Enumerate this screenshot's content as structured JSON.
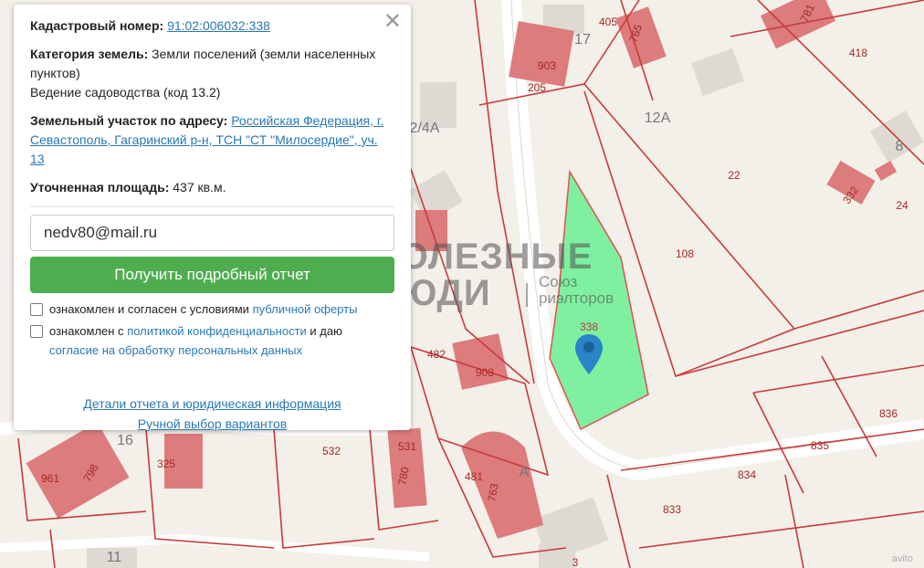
{
  "info": {
    "cadastral_label": "Кадастровый номер:",
    "cadastral_value": "91:02:006032:338",
    "category_label": "Категория земель:",
    "category_value": "Земли поселений (земли населенных пунктов)",
    "category_use": "Ведение садоводства (код 13.2)",
    "address_label": "Земельный участок по адресу:",
    "address_value": "Российская Федерация, г. Севастополь, Гагаринский р-н, ТСН \"СТ \"Милосердие\", уч. 13",
    "area_label": "Уточненная площадь:",
    "area_value": "437 кв.м.",
    "close_glyph": "✕"
  },
  "form": {
    "email_value": "nedv80@mail.ru",
    "button_label": "Получить подробный отчет",
    "check1_text": "ознакомлен и согласен с условиями ",
    "check1_link": "публичной оферты",
    "check2_text": "ознакомлен с ",
    "check2_link": "политикой конфиденциальности",
    "check2_text2": " и даю ",
    "check2_link2": "согласие на обработку персональных данных"
  },
  "links": {
    "details": "Детали отчета и юридическая информация",
    "manual": "Ручной выбор вариантов"
  },
  "watermark": {
    "line1": "ПОЛЕЗНЫЕ",
    "line2": "ЛЮДИ",
    "sub1": "Союз",
    "sub2": "риэлторов"
  },
  "corner_text": "avito",
  "map": {
    "labels": [
      {
        "name": "parcel-label-781",
        "text": "781"
      },
      {
        "name": "parcel-label-418",
        "text": "418"
      },
      {
        "name": "parcel-label-405",
        "text": "405"
      },
      {
        "name": "parcel-label-765",
        "text": "765"
      },
      {
        "name": "parcel-label-17",
        "text": "17"
      },
      {
        "name": "parcel-label-903",
        "text": "903"
      },
      {
        "name": "parcel-label-205",
        "text": "205"
      },
      {
        "name": "parcel-label-12a",
        "text": "12А"
      },
      {
        "name": "parcel-label-8",
        "text": "8"
      },
      {
        "name": "parcel-label-22",
        "text": "22"
      },
      {
        "name": "parcel-label-332",
        "text": "332"
      },
      {
        "name": "parcel-label-24",
        "text": "24"
      },
      {
        "name": "parcel-label-108",
        "text": "108"
      },
      {
        "name": "parcel-label-4a",
        "text": "2/4А"
      },
      {
        "name": "parcel-label-338",
        "text": "338"
      },
      {
        "name": "parcel-label-482",
        "text": "482"
      },
      {
        "name": "parcel-label-908",
        "text": "908"
      },
      {
        "name": "parcel-label-836",
        "text": "836"
      },
      {
        "name": "parcel-label-835",
        "text": "835"
      },
      {
        "name": "parcel-label-834",
        "text": "834"
      },
      {
        "name": "parcel-label-833",
        "text": "833"
      },
      {
        "name": "parcel-label-532",
        "text": "532"
      },
      {
        "name": "parcel-label-531",
        "text": "531"
      },
      {
        "name": "parcel-label-780",
        "text": "780"
      },
      {
        "name": "parcel-label-481",
        "text": "481"
      },
      {
        "name": "parcel-label-763",
        "text": "763"
      },
      {
        "name": "parcel-label-a",
        "text": "А"
      },
      {
        "name": "parcel-label-961",
        "text": "961"
      },
      {
        "name": "parcel-label-798",
        "text": "798"
      },
      {
        "name": "parcel-label-16",
        "text": "16"
      },
      {
        "name": "parcel-label-325",
        "text": "325"
      },
      {
        "name": "parcel-label-11",
        "text": "11"
      },
      {
        "name": "parcel-label-3",
        "text": "3"
      }
    ]
  }
}
